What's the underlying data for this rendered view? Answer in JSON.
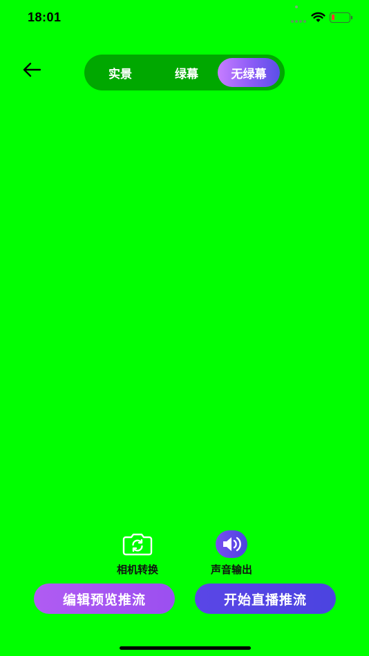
{
  "status_bar": {
    "time": "18:01",
    "icons": [
      "wifi-icon",
      "battery-icon"
    ],
    "battery_color": "#ff3b30"
  },
  "header": {
    "back_icon": "arrow-left-icon",
    "mode_tabs": [
      {
        "label": "实景",
        "active": false
      },
      {
        "label": "绿幕",
        "active": false
      },
      {
        "label": "无绿幕",
        "active": true
      }
    ]
  },
  "tools": {
    "camera_switch": {
      "label": "相机转换",
      "icon": "camera-switch-icon"
    },
    "sound_output": {
      "label": "声音输出",
      "icon": "speaker-icon"
    }
  },
  "actions": {
    "edit_preview_label": "编辑预览推流",
    "start_live_label": "开始直播推流"
  },
  "colors": {
    "background": "#00FF00",
    "switch_bg": "#00A800",
    "accent_purple": "#a855f7",
    "accent_indigo": "#4b44e0"
  }
}
